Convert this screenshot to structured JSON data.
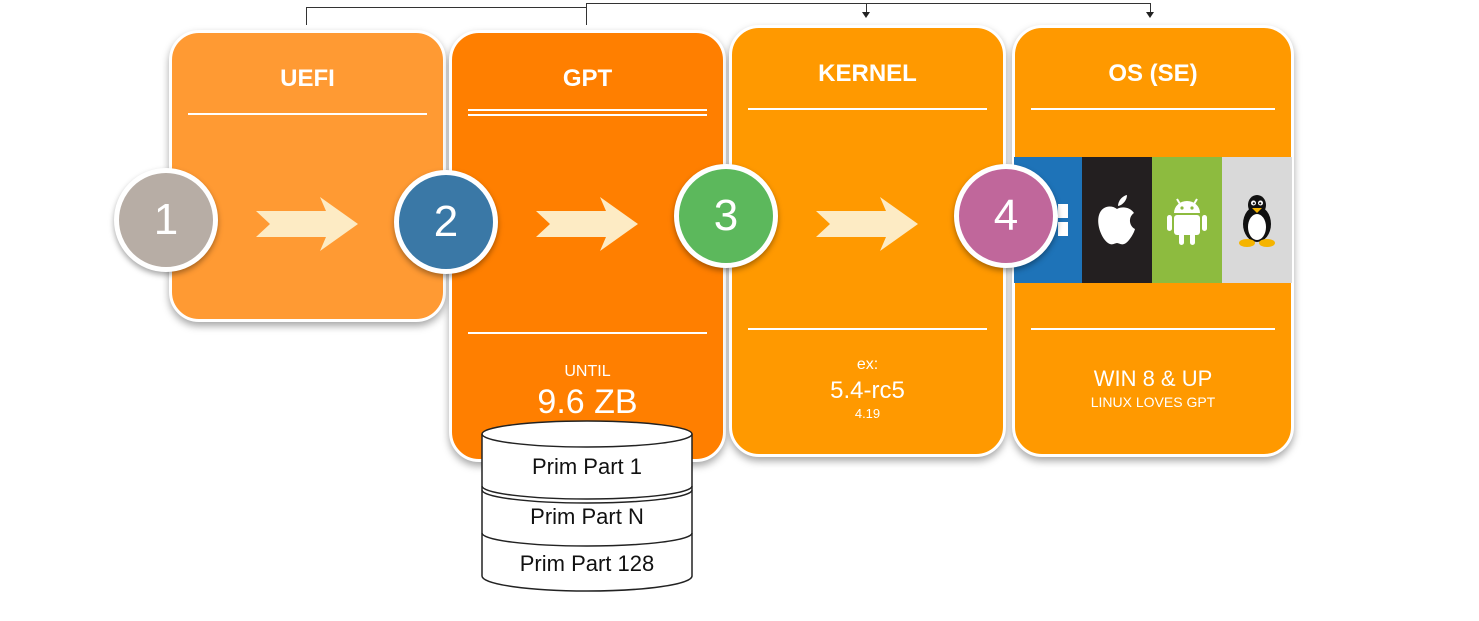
{
  "stages": [
    {
      "number": "1",
      "title": "UEFI"
    },
    {
      "number": "2",
      "title": "GPT",
      "caption_small": "UNTIL",
      "caption_big": "9.6 ZB"
    },
    {
      "number": "3",
      "title": "KERNEL",
      "caption_small": "ex:",
      "caption_big": "5.4-rc5",
      "caption_sub": "4.19"
    },
    {
      "number": "4",
      "title": "OS (SE)",
      "caption_big": "WIN 8 & UP",
      "caption_sub": "LINUX LOVES GPT"
    }
  ],
  "os_logos": [
    "windows-icon",
    "apple-icon",
    "android-icon",
    "linux-tux-icon"
  ],
  "partitions": [
    "Prim Part 1",
    "Prim Part N",
    "Prim Part 128"
  ],
  "colors": {
    "uefi": "#FF9A33",
    "gpt": "#FF7F00",
    "kernel": "#FF9900",
    "os": "#FF9900",
    "circle1": "#B7ADA5",
    "circle2": "#3A78A6",
    "circle3": "#5CB85C",
    "circle4": "#C0679B",
    "chevron": "#FDEBC4"
  }
}
